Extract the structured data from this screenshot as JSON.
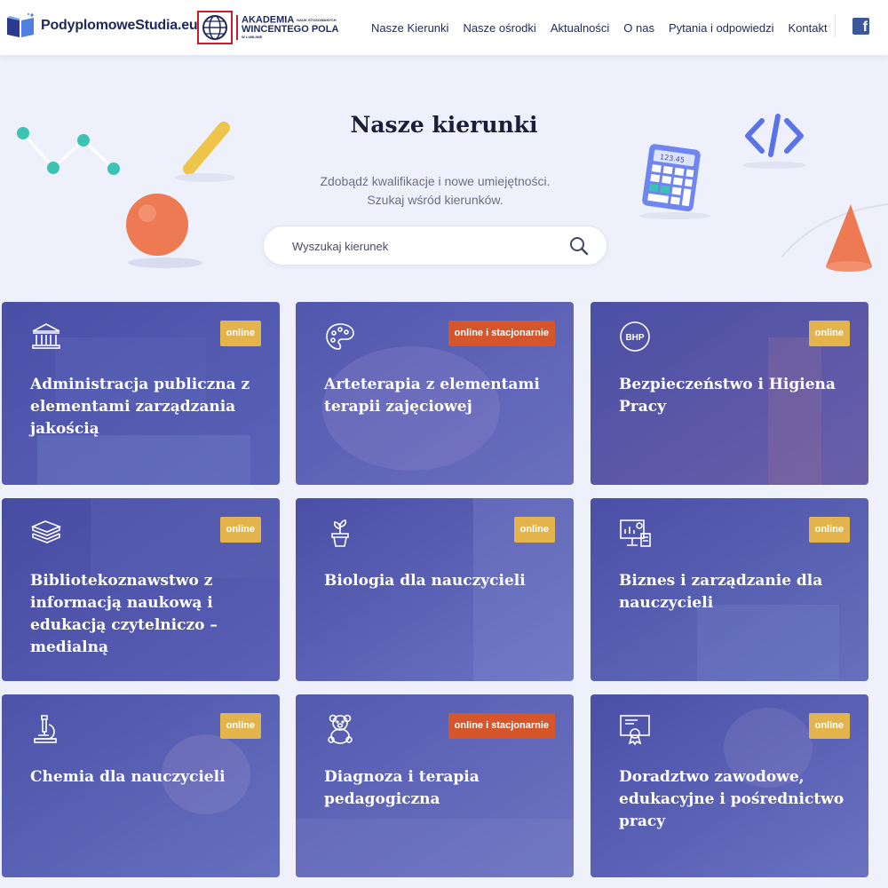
{
  "header": {
    "logo1_text": "PodyplomoweStudia.eu",
    "logo2_line1": "AKADEMIA",
    "logo2_line1_small": "NAUK STOSOWANYCH",
    "logo2_line2": "WINCENTEGO POLA",
    "logo2_line3": "W LUBLINIE",
    "nav": [
      "Nasze Kierunki",
      "Nasze ośrodki",
      "Aktualności",
      "O nas",
      "Pytania i odpowiedzi",
      "Kontakt"
    ],
    "fb_letter": "f"
  },
  "hero": {
    "title": "Nasze kierunki",
    "subtitle_line1": "Zdobądź kwalifikacje i nowe umiejętności.",
    "subtitle_line2": "Szukaj wśród kierunków.",
    "search_placeholder": "Wyszukaj kierunek",
    "calculator_display": "123.45"
  },
  "cards": [
    {
      "title": "Administracja publiczna z elementami zarządzania jakością",
      "badge": "online",
      "icon": "government-building-icon"
    },
    {
      "title": "Arteterapia z elementami terapii zajęciowej",
      "badge": "online i stacjonarnie",
      "icon": "palette-icon"
    },
    {
      "title": "Bezpieczeństwo i Higiena Pracy",
      "badge": "online",
      "icon": "bhp-icon",
      "icon_text": "BHP"
    },
    {
      "title": "Bibliotekoznawstwo z informacją naukową i edukacją czytelniczo – medialną",
      "badge": "online",
      "icon": "books-icon"
    },
    {
      "title": "Biologia dla nauczycieli",
      "badge": "online",
      "icon": "potted-plant-icon"
    },
    {
      "title": "Biznes i zarządzanie dla nauczycieli",
      "badge": "online",
      "icon": "business-chart-icon"
    },
    {
      "title": "Chemia dla nauczycieli",
      "badge": "online",
      "icon": "microscope-icon"
    },
    {
      "title": "Diagnoza i terapia pedagogiczna",
      "badge": "online i stacjonarnie",
      "icon": "teddy-bear-icon"
    },
    {
      "title": "Doradztwo zawodowe, edukacyjne i pośrednictwo pracy",
      "badge": "online",
      "icon": "certificate-icon"
    }
  ],
  "colors": {
    "card_overlay": "#4a4fa6",
    "badge_online": "#e3b34c",
    "badge_stacjonarnie": "#d4562a",
    "background": "#eef1fb"
  }
}
